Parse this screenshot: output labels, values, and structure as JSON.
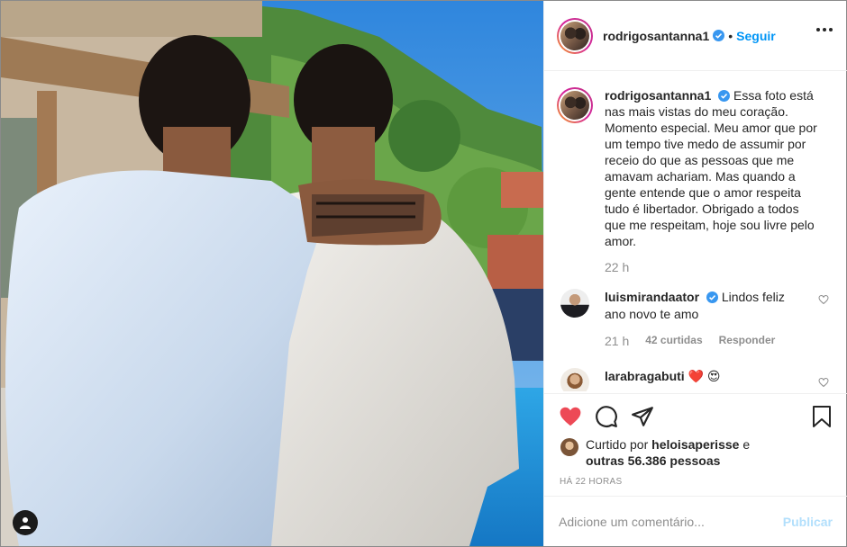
{
  "post": {
    "author": {
      "username": "rodrigosantanna1",
      "verified": true,
      "separator": "•",
      "follow_label": "Seguir",
      "more_icon": "more-horizontal-icon"
    },
    "caption": {
      "text": "Essa foto está nas mais vistas do meu coração. Momento especial. Meu amor que por um tempo tive medo de assumir por receio do que as pessoas que me amavam achariam. Mas quando a gente entende que o amor respeita tudo é libertador. Obrigado a todos que me respeitam, hoje sou livre pelo amor.",
      "time": "22 h"
    },
    "comments": [
      {
        "username": "luismirandaator",
        "verified": true,
        "text": "Lindos feliz ano novo te amo",
        "time": "21 h",
        "likes": "42 curtidas",
        "reply_label": "Responder"
      },
      {
        "username": "larabragabuti",
        "verified": false,
        "text": "❤️ 😍"
      }
    ],
    "actions": {
      "like_icon": "heart-filled-icon",
      "comment_icon": "comment-icon",
      "share_icon": "direct-share-icon",
      "save_icon": "bookmark-icon"
    },
    "likes": {
      "prefix": "Curtido por",
      "liked_by": "heloisaperisse",
      "connector": "e",
      "others": "outras 56.386 pessoas"
    },
    "posted_time": "HÁ 22 HORAS",
    "add_comment": {
      "placeholder": "Adicione um comentário...",
      "publish_label": "Publicar"
    }
  },
  "colors": {
    "link_blue": "#0095f6",
    "publish_disabled": "#b2dffc",
    "like_red": "#ed4956",
    "verified_blue": "#3897f0",
    "muted_text": "#8e8e8e"
  }
}
